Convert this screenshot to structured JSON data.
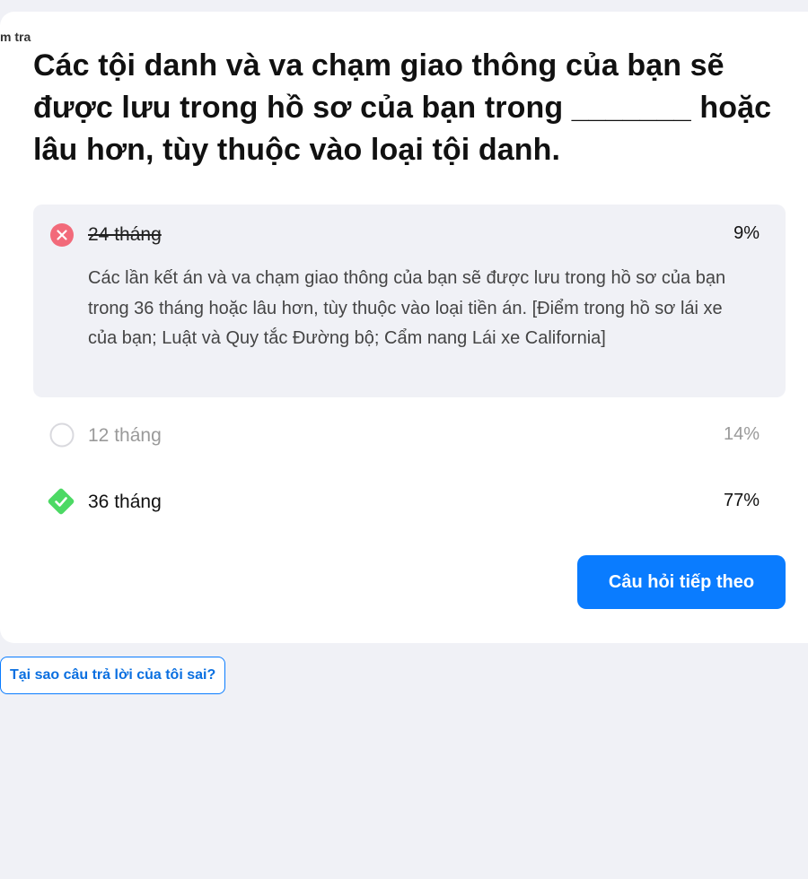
{
  "breadcrumb": "m tra",
  "question": "Các tội danh và va chạm giao thông của bạn sẽ được lưu trong hồ sơ của bạn trong _______ hoặc lâu hơn, tùy thuộc vào loại tội danh.",
  "options": [
    {
      "label": "24 tháng",
      "percent": "9%",
      "state": "wrong-selected",
      "icon": "x-circle-icon",
      "explanation": "Các lần kết án và va chạm giao thông của bạn sẽ được lưu trong hồ sơ của bạn trong 36 tháng hoặc lâu hơn, tùy thuộc vào loại tiền án. [Điểm trong hồ sơ lái xe của bạn; Luật và Quy tắc Đường bộ; Cẩm nang Lái xe California]"
    },
    {
      "label": "12 tháng",
      "percent": "14%",
      "state": "unselected",
      "icon": "empty-circle-icon"
    },
    {
      "label": "36 tháng",
      "percent": "77%",
      "state": "correct",
      "icon": "check-diamond-icon"
    }
  ],
  "next_button": "Câu hỏi tiếp theo",
  "why_button": "Tại sao câu trả lời của tôi sai?",
  "colors": {
    "accent": "#0a7cff",
    "wrong": "#f26a7a",
    "correct": "#4cd964",
    "background": "#f0f1f6"
  }
}
